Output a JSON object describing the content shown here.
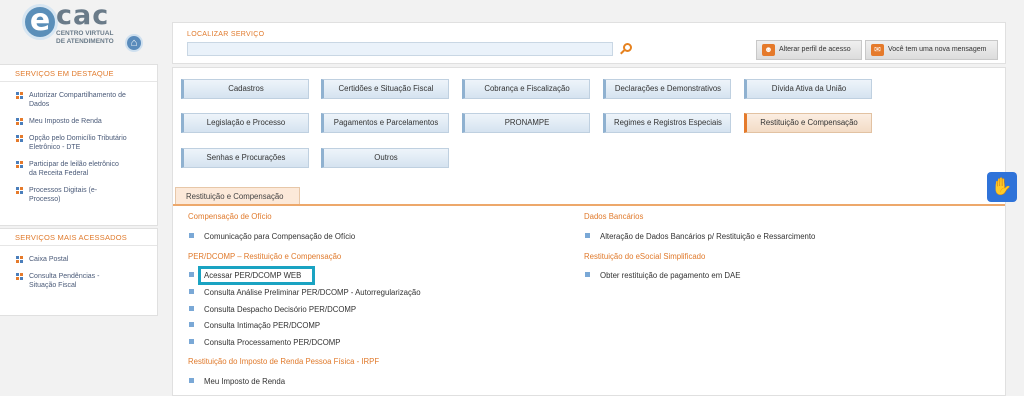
{
  "logo": {
    "letter": "e",
    "name": "cac",
    "subtitle_line1": "CENTRO VIRTUAL",
    "subtitle_line2": "DE ATENDIMENTO"
  },
  "search": {
    "label": "LOCALIZAR SERVIÇO",
    "value": "",
    "placeholder": ""
  },
  "top_buttons": {
    "perfil": "Alterar perfil de acesso",
    "mensagem": "Você tem uma nova mensagem"
  },
  "sidebar": {
    "destaque_title": "SERVIÇOS EM DESTAQUE",
    "destaque_items": [
      {
        "line1": "Autorizar Compartilhamento de",
        "line2": "Dados"
      },
      {
        "line1": "Meu Imposto de Renda",
        "line2": ""
      },
      {
        "line1": "Opção pelo Domicílio Tributário",
        "line2": "Eletrônico - DTE"
      },
      {
        "line1": "Participar de leilão eletrônico",
        "line2": "da Receita Federal"
      },
      {
        "line1": "Processos Digitais (e-",
        "line2": "Processo)"
      }
    ],
    "acessados_title": "SERVIÇOS MAIS ACESSADOS",
    "acessados_items": [
      {
        "line1": "Caixa Postal",
        "line2": ""
      },
      {
        "line1": "Consulta Pendências -",
        "line2": "Situação Fiscal"
      }
    ]
  },
  "categories": [
    "Cadastros",
    "Certidões e Situação Fiscal",
    "Cobrança e Fiscalização",
    "Declarações e Demonstrativos",
    "Dívida Ativa da União",
    "Legislação e Processo",
    "Pagamentos e Parcelamentos",
    "PRONAMPE",
    "Regimes e Registros Especiais",
    "Restituição e Compensação",
    "Senhas e Procurações",
    "Outros"
  ],
  "active_category": "Restituição e Compensação",
  "section": {
    "tab": "Restituição e Compensação",
    "left": {
      "group1_title": "Compensação de Ofício",
      "group1_items": [
        "Comunicação para Compensação de Ofício"
      ],
      "group2_title": "PER/DCOMP – Restituição e Compensação",
      "group2_items": [
        "Acessar PER/DCOMP WEB",
        "Consulta Análise Preliminar PER/DCOMP - Autorregularização",
        "Consulta Despacho Decisório PER/DCOMP",
        "Consulta Intimação PER/DCOMP",
        "Consulta Processamento PER/DCOMP"
      ],
      "group3_title": "Restituição do Imposto de Renda Pessoa Física - IRPF",
      "group3_items": [
        "Meu Imposto de Renda"
      ]
    },
    "right": {
      "group1_title": "Dados Bancários",
      "group1_items": [
        "Alteração de Dados Bancários p/ Restituição e Ressarcimento"
      ],
      "group2_title": "Restituição do eSocial Simplificado",
      "group2_items": [
        "Obter restituição de pagamento em DAE"
      ]
    }
  },
  "accent_colors": {
    "orange": "#e07a2c",
    "blue_button": "#d5e3f0",
    "highlight": "#1aa3c2"
  },
  "icons": {
    "home": "home-icon",
    "search": "search-icon",
    "perfil": "users-icon",
    "mensagem": "mail-icon",
    "a11y": "sign-language-icon"
  }
}
